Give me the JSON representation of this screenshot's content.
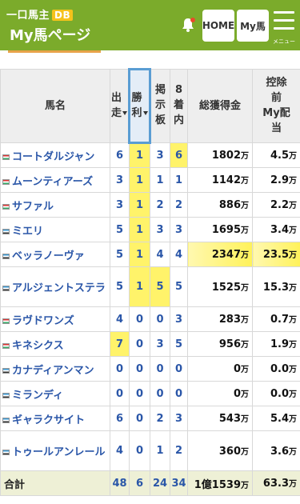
{
  "header": {
    "logo_text": "一口馬主",
    "logo_badge": "DB",
    "page_title": "My馬ページ",
    "home_label": "HOME",
    "my_horse_label": "My馬",
    "menu_label": "メニュー",
    "bell_icon": "bell-icon",
    "accent_color": "#7bab2b"
  },
  "table": {
    "headers": {
      "name": "馬名",
      "starts": "出走",
      "wins": "勝利",
      "board": "掲示板",
      "top8": "8着内",
      "earnings": "総獲得金",
      "distribution": "控除前My配当"
    },
    "rows": [
      {
        "name": "コートダルジャン",
        "starts": "6",
        "wins": "1",
        "board": "3",
        "top8": "6",
        "earnings": "1802",
        "dist": "4.5"
      },
      {
        "name": "ムーンティアーズ",
        "starts": "3",
        "wins": "1",
        "board": "1",
        "top8": "1",
        "earnings": "1142",
        "dist": "2.9"
      },
      {
        "name": "サファル",
        "starts": "3",
        "wins": "1",
        "board": "2",
        "top8": "2",
        "earnings": "886",
        "dist": "2.2"
      },
      {
        "name": "ミエリ",
        "starts": "5",
        "wins": "1",
        "board": "3",
        "top8": "3",
        "earnings": "1695",
        "dist": "3.4"
      },
      {
        "name": "ベッラノーヴァ",
        "starts": "5",
        "wins": "1",
        "board": "4",
        "top8": "4",
        "earnings": "2347",
        "dist": "23.5"
      },
      {
        "name": "アルジェントステラ",
        "starts": "5",
        "wins": "1",
        "board": "5",
        "top8": "5",
        "earnings": "1525",
        "dist": "15.3"
      },
      {
        "name": "ラヴドワンズ",
        "starts": "4",
        "wins": "0",
        "board": "0",
        "top8": "3",
        "earnings": "283",
        "dist": "0.7"
      },
      {
        "name": "キネシクス",
        "starts": "7",
        "wins": "0",
        "board": "3",
        "top8": "5",
        "earnings": "956",
        "dist": "1.9"
      },
      {
        "name": "カナディアンマン",
        "starts": "0",
        "wins": "0",
        "board": "0",
        "top8": "0",
        "earnings": "0",
        "dist": "0.0"
      },
      {
        "name": "ミランディ",
        "starts": "0",
        "wins": "0",
        "board": "0",
        "top8": "0",
        "earnings": "0",
        "dist": "0.0"
      },
      {
        "name": "ギャラクサイト",
        "starts": "6",
        "wins": "0",
        "board": "2",
        "top8": "3",
        "earnings": "543",
        "dist": "5.4"
      },
      {
        "name": "トゥールアンレール",
        "starts": "4",
        "wins": "0",
        "board": "1",
        "top8": "2",
        "earnings": "360",
        "dist": "3.6"
      }
    ],
    "unit": "万",
    "total": {
      "label": "合計",
      "starts": "48",
      "wins": "6",
      "board": "24",
      "top8": "34",
      "earnings": "1億1539",
      "dist": "63.3"
    }
  }
}
